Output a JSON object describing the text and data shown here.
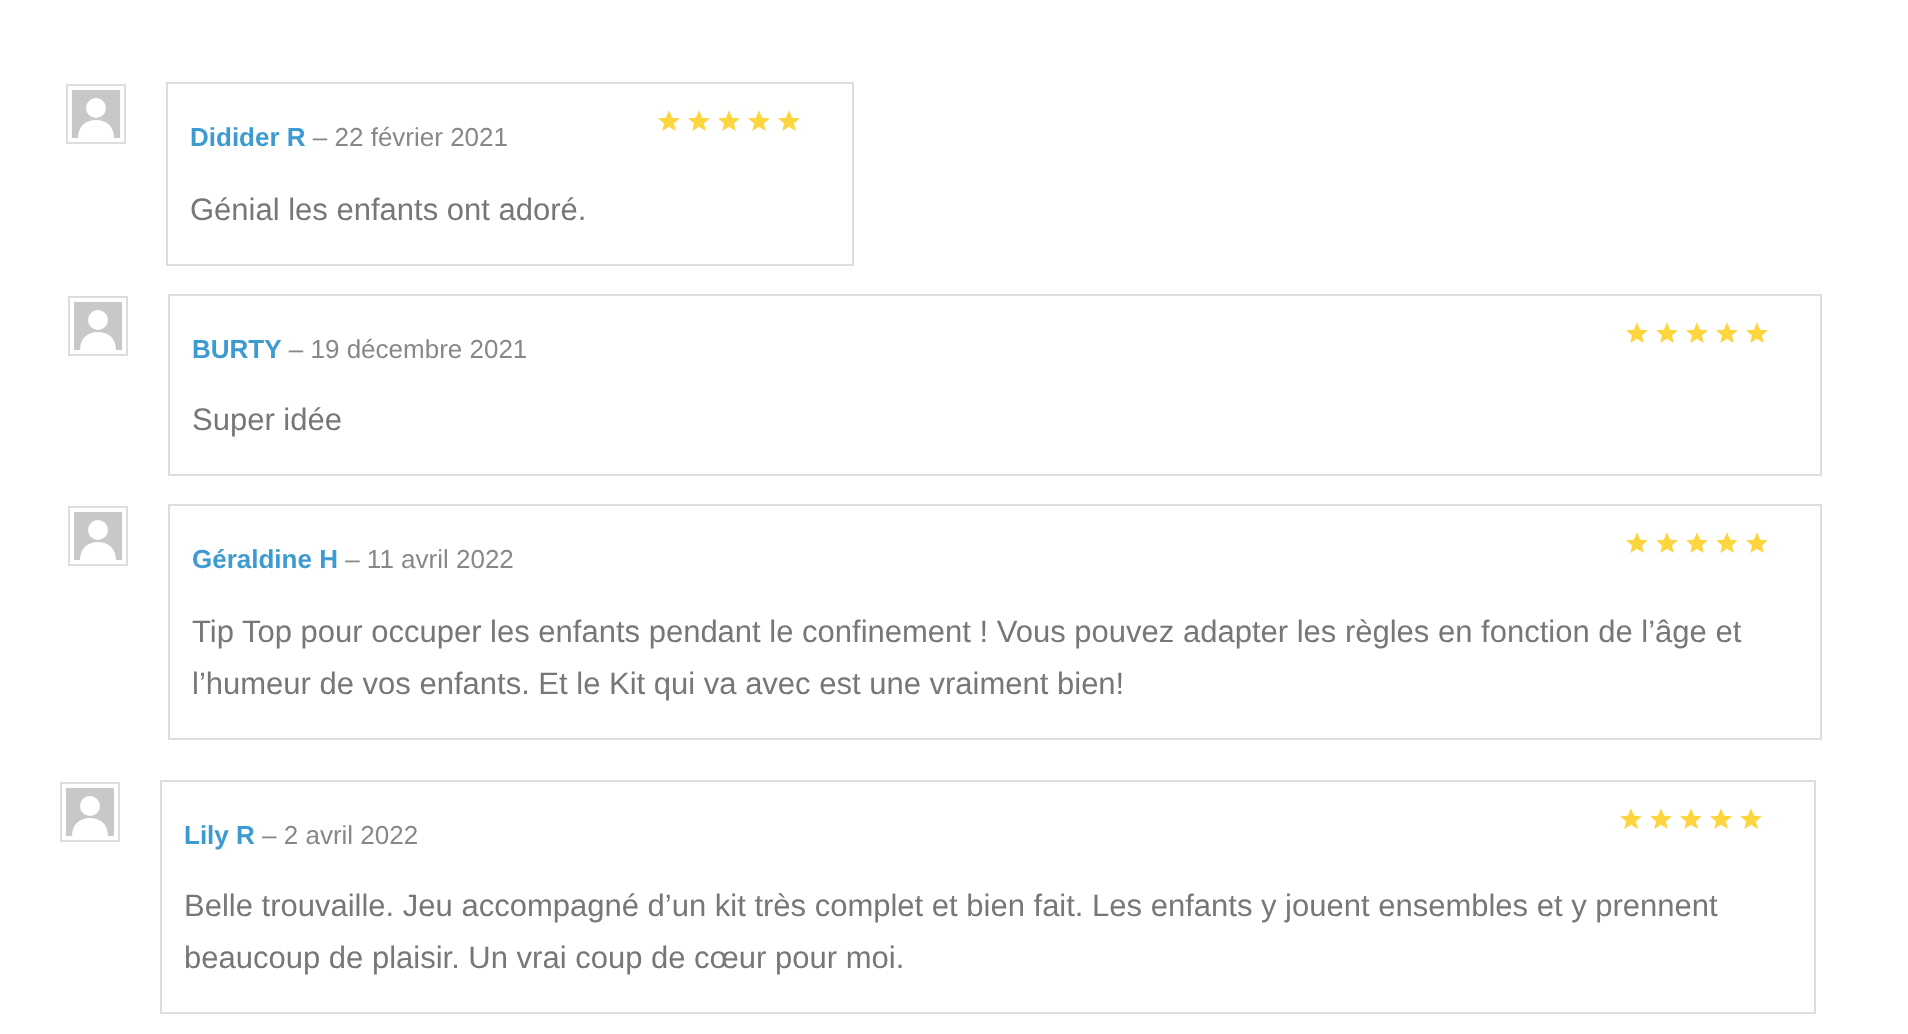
{
  "reviews": [
    {
      "author": "Didider R",
      "date": "– 22 février 2021",
      "stars": 5,
      "text": "Génial les enfants ont adoré."
    },
    {
      "author": "BURTY",
      "date": "– 19 décembre 2021",
      "stars": 5,
      "text": "Super idée"
    },
    {
      "author": "Géraldine H",
      "date": "– 11 avril 2022",
      "stars": 5,
      "text": "Tip Top pour occuper les enfants pendant le confinement ! Vous pouvez adapter les règles en fonction de l’âge et l’humeur de vos enfants. Et le Kit qui va avec est une vraiment bien!"
    },
    {
      "author": "Lily R",
      "date": "– 2 avril 2022",
      "stars": 5,
      "text": "Belle trouvaille. Jeu accompagné d’un kit très complet et bien fait. Les enfants y jouent ensembles et y prennent beaucoup de plaisir. Un vrai coup de cœur pour moi."
    }
  ]
}
